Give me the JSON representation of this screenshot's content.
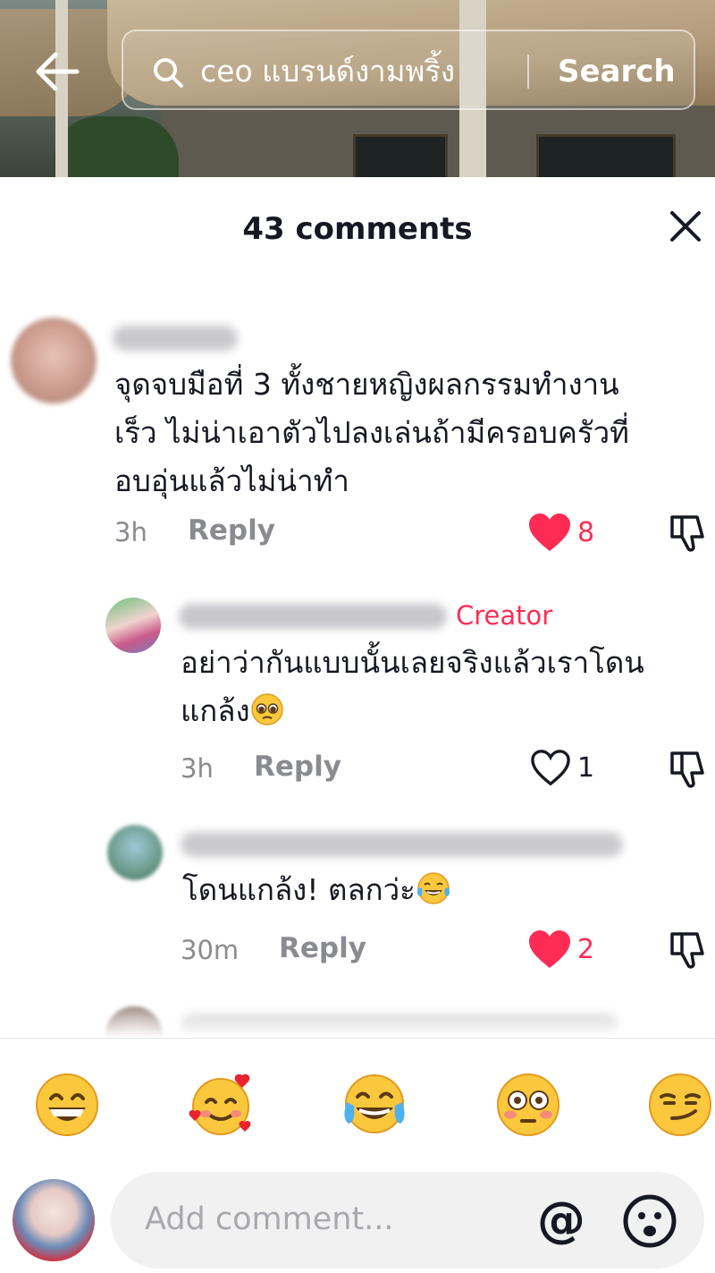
{
  "search": {
    "query": "ceo แบรนด์งามพริ้ง",
    "button_label": "Search"
  },
  "panel": {
    "title": "43 comments"
  },
  "comments": [
    {
      "text_lines": [
        "จุดจบมือที่ 3 ทั้งชายหญิงผลกรรมทำงาน",
        "เร็ว ไม่น่าเอาตัวไปลงเล่นถ้ามีครอบครัวที่",
        "อบอุ่นแล้วไม่น่าทำ"
      ],
      "time": "3h",
      "reply_label": "Reply",
      "likes": "8",
      "liked": true
    },
    {
      "creator_label": "Creator",
      "text_lines": [
        "อย่าว่ากันแบบนั้นเลยจริงแล้วเราโดน",
        "แกล้ง"
      ],
      "time": "3h",
      "reply_label": "Reply",
      "likes": "1",
      "liked": false
    },
    {
      "text_lines": [
        "โดนแกล้ง! ตลกว่ะ"
      ],
      "time": "30m",
      "reply_label": "Reply",
      "likes": "2",
      "liked": true
    }
  ],
  "quick_emojis": [
    "grin-emoji",
    "smiling-face-with-hearts-emoji",
    "tears-of-joy-emoji",
    "flushed-emoji",
    "smirk-emoji"
  ],
  "composer": {
    "placeholder": "Add comment...",
    "mention_symbol": "@"
  },
  "colors": {
    "like_active": "#fe2c55",
    "creator": "#fe2c55",
    "muted": "#8a8b91"
  }
}
